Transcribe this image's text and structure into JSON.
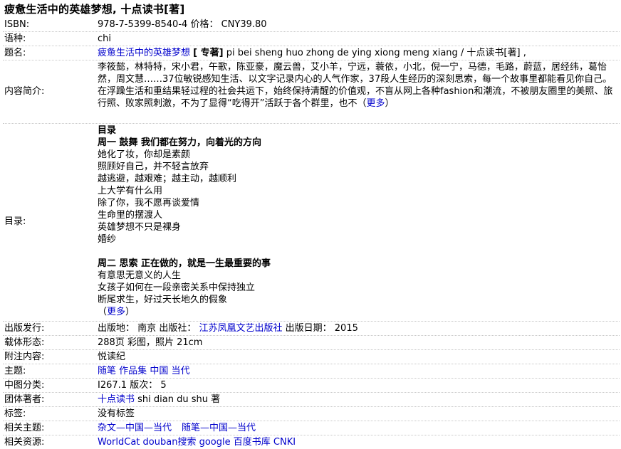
{
  "title": "疲惫生活中的英雄梦想, 十点读书[著]",
  "labels": {
    "isbn": "ISBN:",
    "language": "语种:",
    "title": "题名:",
    "summary": "内容简介:",
    "toc": "目录:",
    "publish": "出版发行:",
    "form": "载体形态:",
    "note": "附注内容:",
    "subject": "主题:",
    "clc": "中图分类:",
    "corp_author": "团体著者:",
    "tags": "标签:",
    "related_subjects": "相关主题:",
    "related_resources": "相关资源:"
  },
  "isbn": {
    "number": "978-7-5399-8540-4",
    "price_label": "价格：",
    "price": "CNY39.80"
  },
  "language": "chi",
  "title_field": {
    "link": "疲惫生活中的英雄梦想",
    "type": "[ 专著]",
    "pinyin": " pi bei sheng huo zhong de ying xiong meng xiang / 十点读书[著] ,"
  },
  "summary": {
    "text": "李筱懿，林特特，宋小君，午歌，陈亚豪，魔云兽，艾小羊，宁远，蓑依，小北，倪一宁，马德，毛路，蔚蓝，居经纬，葛怡然，周文慧……37位敏锐感知生活、以文字记录内心的人气作家，37段人生经历的深刻思索，每一个故事里都能看见你自己。在浮躁生活和重结果轻过程的社会共运下，始终保持清醒的价值观，不盲从网上各种fashion和潮流，不被朋友圈里的美照、旅行照、败家照刺激，不为了显得“吃得开”活跃于各个群里，也不（",
    "more": "更多",
    "close": "）"
  },
  "toc": {
    "heading": "目录",
    "section1_title": "周一 鼓舞 我们都在努力，向着光的方向",
    "section1_items": [
      "她化了妆，你却是素颜",
      "照顾好自己，并不轻言放弃",
      "越逃避，越艰难；越主动，越顺利",
      "上大学有什么用",
      "除了你，我不愿再谈爱情",
      "生命里的摆渡人",
      "英雄梦想不只是裸身",
      "婚纱"
    ],
    "section2_title": "周二 思索 正在做的，就是一生最重要的事",
    "section2_items": [
      "有意思无意义的人生",
      "女孩子如何在一段亲密关系中保持独立",
      "断尾求生，好过天长地久的假象"
    ],
    "more_open": "（",
    "more": "更多",
    "more_close": "）"
  },
  "publish": {
    "place_label": "出版地：",
    "place": "南京",
    "publisher_label": "出版社：",
    "publisher": "江苏凤凰文艺出版社",
    "date_label": "出版日期：",
    "date": "2015"
  },
  "form": "288页 彩图，照片 21cm",
  "note": "悦读纪",
  "subject": [
    "随笔",
    "作品集",
    "中国",
    "当代"
  ],
  "clc": {
    "code": "I267.1",
    "edition_label": "版次：",
    "edition": "5"
  },
  "corp_author": {
    "link": "十点读书",
    "rest": " shi dian du shu 著"
  },
  "tags": "没有标签",
  "related_subjects": [
    "杂文—中国—当代",
    "随笔—中国—当代"
  ],
  "related_resources": [
    "WorldCat",
    "douban搜索",
    "google",
    "百度书库",
    "CNKI"
  ]
}
